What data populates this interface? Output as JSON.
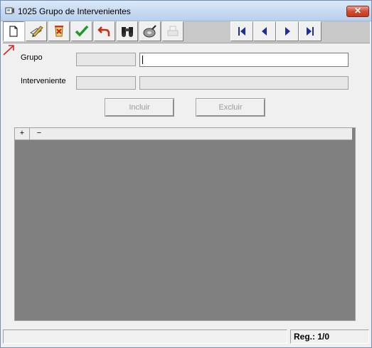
{
  "window": {
    "title": "1025 Grupo de Intervenientes",
    "close_label": "✕"
  },
  "toolbar": {
    "buttons": [
      {
        "icon": "new-document-icon",
        "state": "pressed"
      },
      {
        "icon": "edit-pencil-icon",
        "state": "normal"
      },
      {
        "icon": "delete-eraser-icon",
        "state": "normal"
      },
      {
        "icon": "confirm-check-icon",
        "state": "normal"
      },
      {
        "icon": "undo-arrow-icon",
        "state": "normal"
      },
      {
        "icon": "search-binoculars-icon",
        "state": "normal"
      },
      {
        "icon": "lookup-disk-icon",
        "state": "normal"
      },
      {
        "icon": "print-disabled-icon",
        "state": "disabled"
      }
    ],
    "nav": [
      {
        "icon": "first-record-icon",
        "glyph": "|◀"
      },
      {
        "icon": "previous-record-icon",
        "glyph": "◀"
      },
      {
        "icon": "next-record-icon",
        "glyph": "▶"
      },
      {
        "icon": "last-record-icon",
        "glyph": "▶|"
      }
    ]
  },
  "form": {
    "grupo_label": "Grupo",
    "interveniente_label": "Interveniente",
    "grupo_code": "",
    "grupo_desc": "",
    "interveniente_code": "",
    "interveniente_desc": ""
  },
  "actions": {
    "incluir_label": "Incluir",
    "excluir_label": "Excluir"
  },
  "grid": {
    "expand_label": "+",
    "collapse_label": "−"
  },
  "status": {
    "left": "",
    "reg": "Reg.: 1/0"
  },
  "colors": {
    "nav_arrow": "#1a2f9a",
    "check_green": "#1a9a2a",
    "undo_red": "#cc2a10",
    "annotation_red": "#e02020",
    "grid_bg": "#808080"
  }
}
